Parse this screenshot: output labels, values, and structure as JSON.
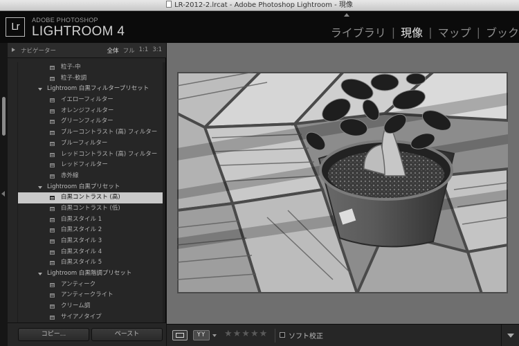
{
  "window": {
    "title": "LR-2012-2.lrcat - Adobe Photoshop Lightroom - 現像"
  },
  "identity_plate": {
    "logo_text": "Lr",
    "brand_small": "ADOBE PHOTOSHOP",
    "brand_large": "LIGHTROOM 4"
  },
  "modules": [
    {
      "label": "ライブラリ",
      "active": false
    },
    {
      "label": "現像",
      "active": true
    },
    {
      "label": "マップ",
      "active": false
    },
    {
      "label": "ブック",
      "active": false
    }
  ],
  "module_separator": "|",
  "navigator": {
    "title": "ナビゲーター",
    "options": [
      "全体",
      "フル",
      "1:1",
      "3:1"
    ],
    "active_option": "全体"
  },
  "presets": [
    {
      "type": "item",
      "label": "粒子-中"
    },
    {
      "type": "item",
      "label": "粒子-軟調"
    },
    {
      "type": "folder",
      "label": "Lightroom 白黒フィルタープリセット"
    },
    {
      "type": "item",
      "label": "イエローフィルター"
    },
    {
      "type": "item",
      "label": "オレンジフィルター"
    },
    {
      "type": "item",
      "label": "グリーンフィルター"
    },
    {
      "type": "item",
      "label": "ブルーコントラスト (高) フィルター"
    },
    {
      "type": "item",
      "label": "ブルーフィルター"
    },
    {
      "type": "item",
      "label": "レッドコントラスト (高) フィルター"
    },
    {
      "type": "item",
      "label": "レッドフィルター"
    },
    {
      "type": "item",
      "label": "赤外線"
    },
    {
      "type": "folder",
      "label": "Lightroom 白黒プリセット"
    },
    {
      "type": "item",
      "label": "白黒コントラスト (高)",
      "selected": true
    },
    {
      "type": "item",
      "label": "白黒コントラスト (低)"
    },
    {
      "type": "item",
      "label": "白黒スタイル 1"
    },
    {
      "type": "item",
      "label": "白黒スタイル 2"
    },
    {
      "type": "item",
      "label": "白黒スタイル 3"
    },
    {
      "type": "item",
      "label": "白黒スタイル 4"
    },
    {
      "type": "item",
      "label": "白黒スタイル 5"
    },
    {
      "type": "folder",
      "label": "Lightroom 白黒階調プリセット"
    },
    {
      "type": "item",
      "label": "アンティーク"
    },
    {
      "type": "item",
      "label": "アンティークライト"
    },
    {
      "type": "item",
      "label": "クリーム調"
    },
    {
      "type": "item",
      "label": "サイアノタイプ"
    }
  ],
  "left_buttons": {
    "copy": "コピー...",
    "paste": "ペースト"
  },
  "toolbar": {
    "yy_label": "YY",
    "stars": "★★★★★",
    "soft_proof_label": "ソフト校正",
    "soft_proof_checked": false
  },
  "colors": {
    "selected_row": "#c9c9c9",
    "center_background": "#6f6f6f",
    "active_module": "#e6e6e6"
  }
}
